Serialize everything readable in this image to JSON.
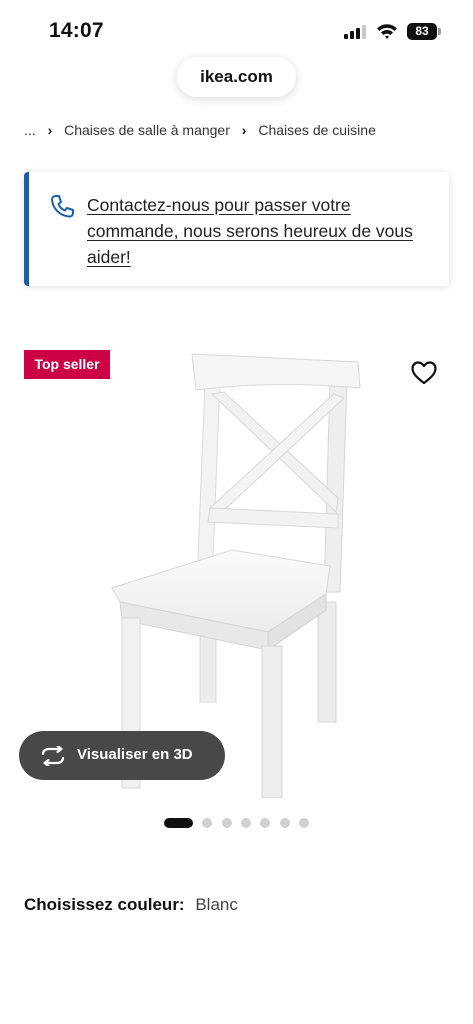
{
  "status_bar": {
    "time": "14:07",
    "battery": "83",
    "icons": [
      "signal-icon",
      "wifi-icon",
      "battery-icon"
    ]
  },
  "browser": {
    "url": "ikea.com"
  },
  "breadcrumb": {
    "items": [
      "...",
      "Chaises de salle à manger",
      "Chaises de cuisine"
    ]
  },
  "contact": {
    "text": "Contactez-nous pour passer votre commande, nous serons heureux de vous aider!",
    "accent_color": "#1b5fa7"
  },
  "product": {
    "badge": "Top seller",
    "badge_color": "#cc0044",
    "visualize_label": "Visualiser en 3D",
    "gallery_images_total": 7,
    "gallery_active_index": 1
  },
  "color_selector": {
    "label": "Choisissez couleur:",
    "value": "Blanc"
  }
}
